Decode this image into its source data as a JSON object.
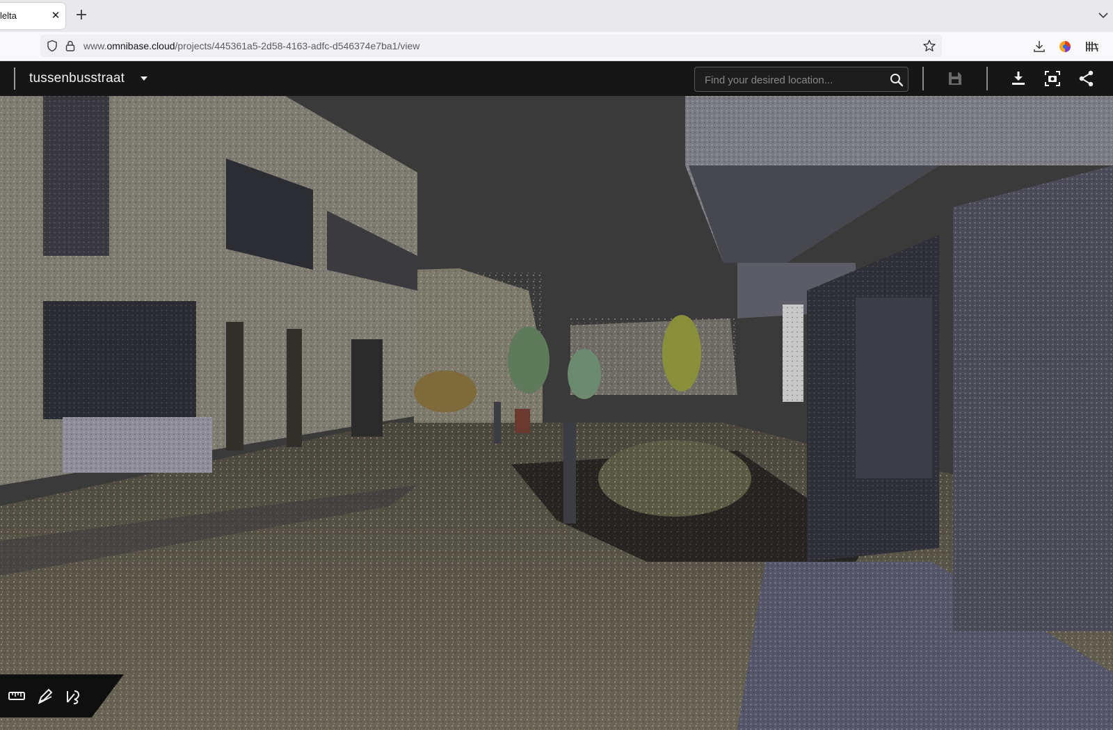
{
  "browser": {
    "tab": {
      "title": "lelta",
      "close_icon": "close-icon"
    },
    "new_tab_label": "+",
    "url_prefix": "www.",
    "url_host": "omnibase.cloud",
    "url_path": "/projects/445361a5-2d58-4163-adfc-d546374e7ba1/view"
  },
  "viewer": {
    "project_name": "tussenbusstraat",
    "search": {
      "placeholder": "Find your desired location..."
    },
    "tools": {
      "save": "save-icon",
      "download": "download-icon",
      "screenshot": "screenshot-icon",
      "share": "share-icon"
    },
    "bottom_tools": [
      "ruler-icon",
      "draw-icon",
      "angle-measure-icon"
    ]
  },
  "colors": {
    "sky": "#3a3a3a",
    "topbar": "#161616",
    "ground": "#5d5848",
    "building_left": "#7e7b70",
    "building_right": "#4c4c5a",
    "vegetation": "#5e6e3e"
  }
}
